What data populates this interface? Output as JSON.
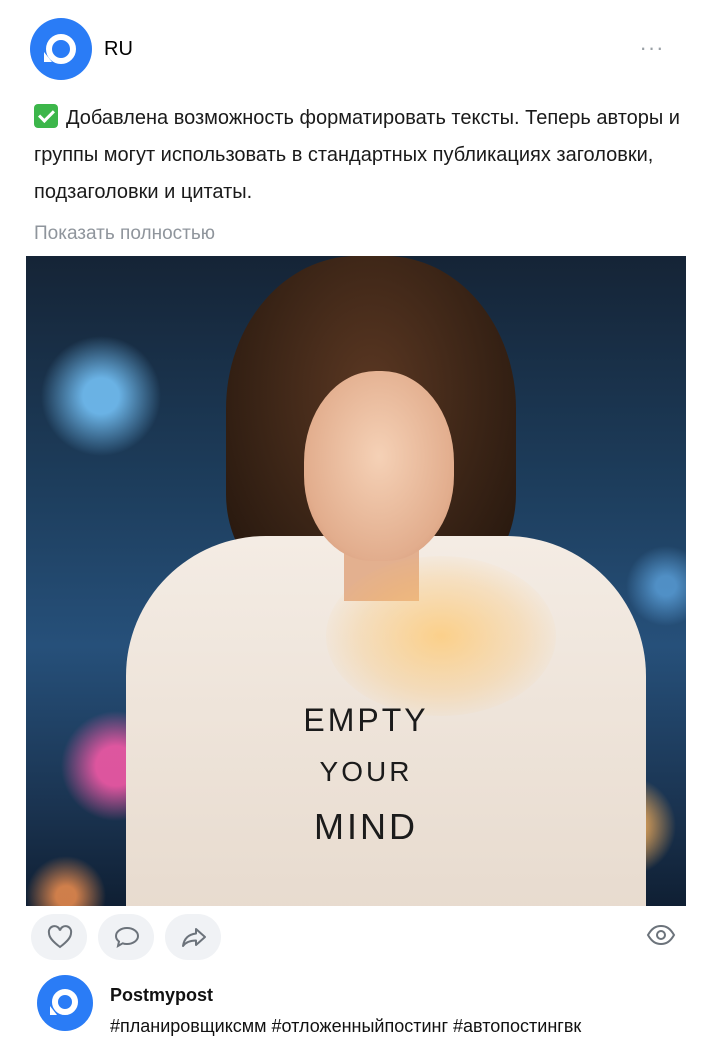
{
  "post": {
    "author_name": "RU",
    "more_icon": "more-horizontal-icon",
    "text": "Добавлена возможность форматировать тексты. Теперь авторы и группы могут использовать в стандартных публикациях заголовки, подзаголовки и цитаты.",
    "text_emoji": "check-mark-button-icon",
    "show_more_label": "Показать полностью",
    "photo": {
      "shirt_line1": "EMPTY",
      "shirt_line2": "YOUR",
      "shirt_line3": "MIND"
    }
  },
  "actions": {
    "like_icon": "heart-icon",
    "comment_icon": "comment-icon",
    "share_icon": "share-icon",
    "views_icon": "eye-icon"
  },
  "footer": {
    "name": "Postmypost",
    "hashtags": "#планировщиксмм #отложенныйпостинг #автопостингвк"
  },
  "colors": {
    "brand_blue": "#2a7cf6",
    "check_green": "#3cb64a",
    "muted_text": "#8f959c",
    "button_bg": "#f0f2f5"
  }
}
